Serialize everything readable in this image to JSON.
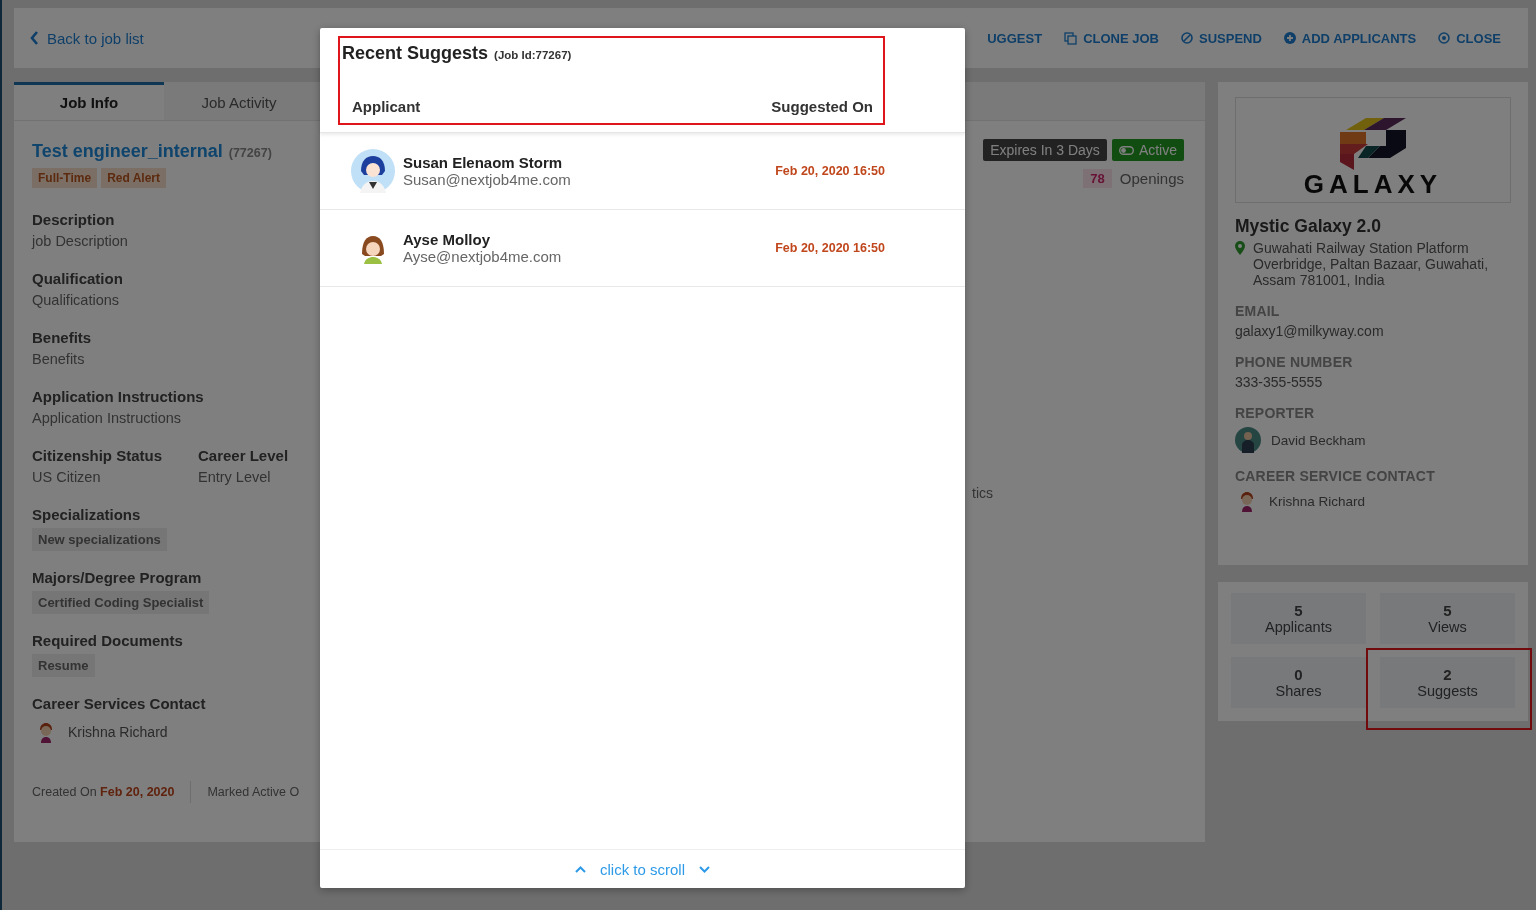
{
  "top_bar": {
    "back_link": "Back to job list",
    "actions": [
      "UGGEST",
      "CLONE JOB",
      "SUSPEND",
      "ADD APPLICANTS",
      "CLOSE"
    ]
  },
  "tabs": [
    {
      "label": "Job Info",
      "selected": true
    },
    {
      "label": "Job Activity",
      "selected": false
    }
  ],
  "job": {
    "title": "Test engineer_internal",
    "id": "(77267)",
    "tags": [
      "Full-Time",
      "Red Alert"
    ],
    "expires": "Expires In 3 Days",
    "status": {
      "label": "Active",
      "on": true
    },
    "openings_count": "78",
    "openings_label": "Openings",
    "side_text": "tics",
    "sections": [
      {
        "kind": "text",
        "heading": "Description",
        "value": "job Description"
      },
      {
        "kind": "text",
        "heading": "Qualification",
        "value": "Qualifications"
      },
      {
        "kind": "text",
        "heading": "Benefits",
        "value": "Benefits"
      },
      {
        "kind": "text",
        "heading": "Application Instructions",
        "value": "Application Instructions"
      },
      {
        "kind": "pair",
        "items": [
          {
            "heading": "Citizenship Status",
            "value": "US Citizen"
          },
          {
            "heading": "Career Level",
            "value": "Entry Level"
          }
        ]
      },
      {
        "kind": "chips",
        "heading": "Specializations",
        "chips": [
          "New specializations"
        ]
      },
      {
        "kind": "chips",
        "heading": "Majors/Degree Program",
        "chips": [
          "Certified Coding Specialist"
        ]
      },
      {
        "kind": "chips",
        "heading": "Required Documents",
        "chips": [
          "Resume"
        ]
      },
      {
        "kind": "person",
        "heading": "Career Services Contact",
        "name": "Krishna Richard"
      }
    ],
    "created_label": "Created On",
    "created_date": "Feb 20, 2020",
    "marked_active": "Marked Active O"
  },
  "company": {
    "logo_text": "GALAXY",
    "name": "Mystic Galaxy 2.0",
    "address": "Guwahati Railway Station Platform Overbridge, Paltan Bazaar, Guwahati, Assam 781001, India",
    "fields": [
      {
        "kind": "text",
        "label": "EMAIL",
        "value": "galaxy1@milkyway.com"
      },
      {
        "kind": "text",
        "label": "PHONE NUMBER",
        "value": "333-355-5555"
      },
      {
        "kind": "person",
        "label": "REPORTER",
        "value": "David Beckham"
      },
      {
        "kind": "person",
        "label": "CAREER SERVICE CONTACT",
        "value": "Krishna Richard"
      }
    ]
  },
  "stats": [
    {
      "count": "5",
      "label": "Applicants",
      "highlighted": false
    },
    {
      "count": "5",
      "label": "Views",
      "highlighted": false
    },
    {
      "count": "0",
      "label": "Shares",
      "highlighted": false
    },
    {
      "count": "2",
      "label": "Suggests",
      "highlighted": true
    }
  ],
  "modal": {
    "title": "Recent Suggests",
    "subtitle": "(Job Id:77267)",
    "header_highlighted": true,
    "columns": [
      "Applicant",
      "Suggested On"
    ],
    "rows": [
      {
        "name": "Susan Elenaom Storm",
        "email": "Susan@nextjob4me.com",
        "date": "Feb 20, 2020 16:50"
      },
      {
        "name": "Ayse Molloy",
        "email": "Ayse@nextjob4me.com",
        "date": "Feb 20, 2020 16:50"
      }
    ],
    "footer": "click to scroll"
  }
}
